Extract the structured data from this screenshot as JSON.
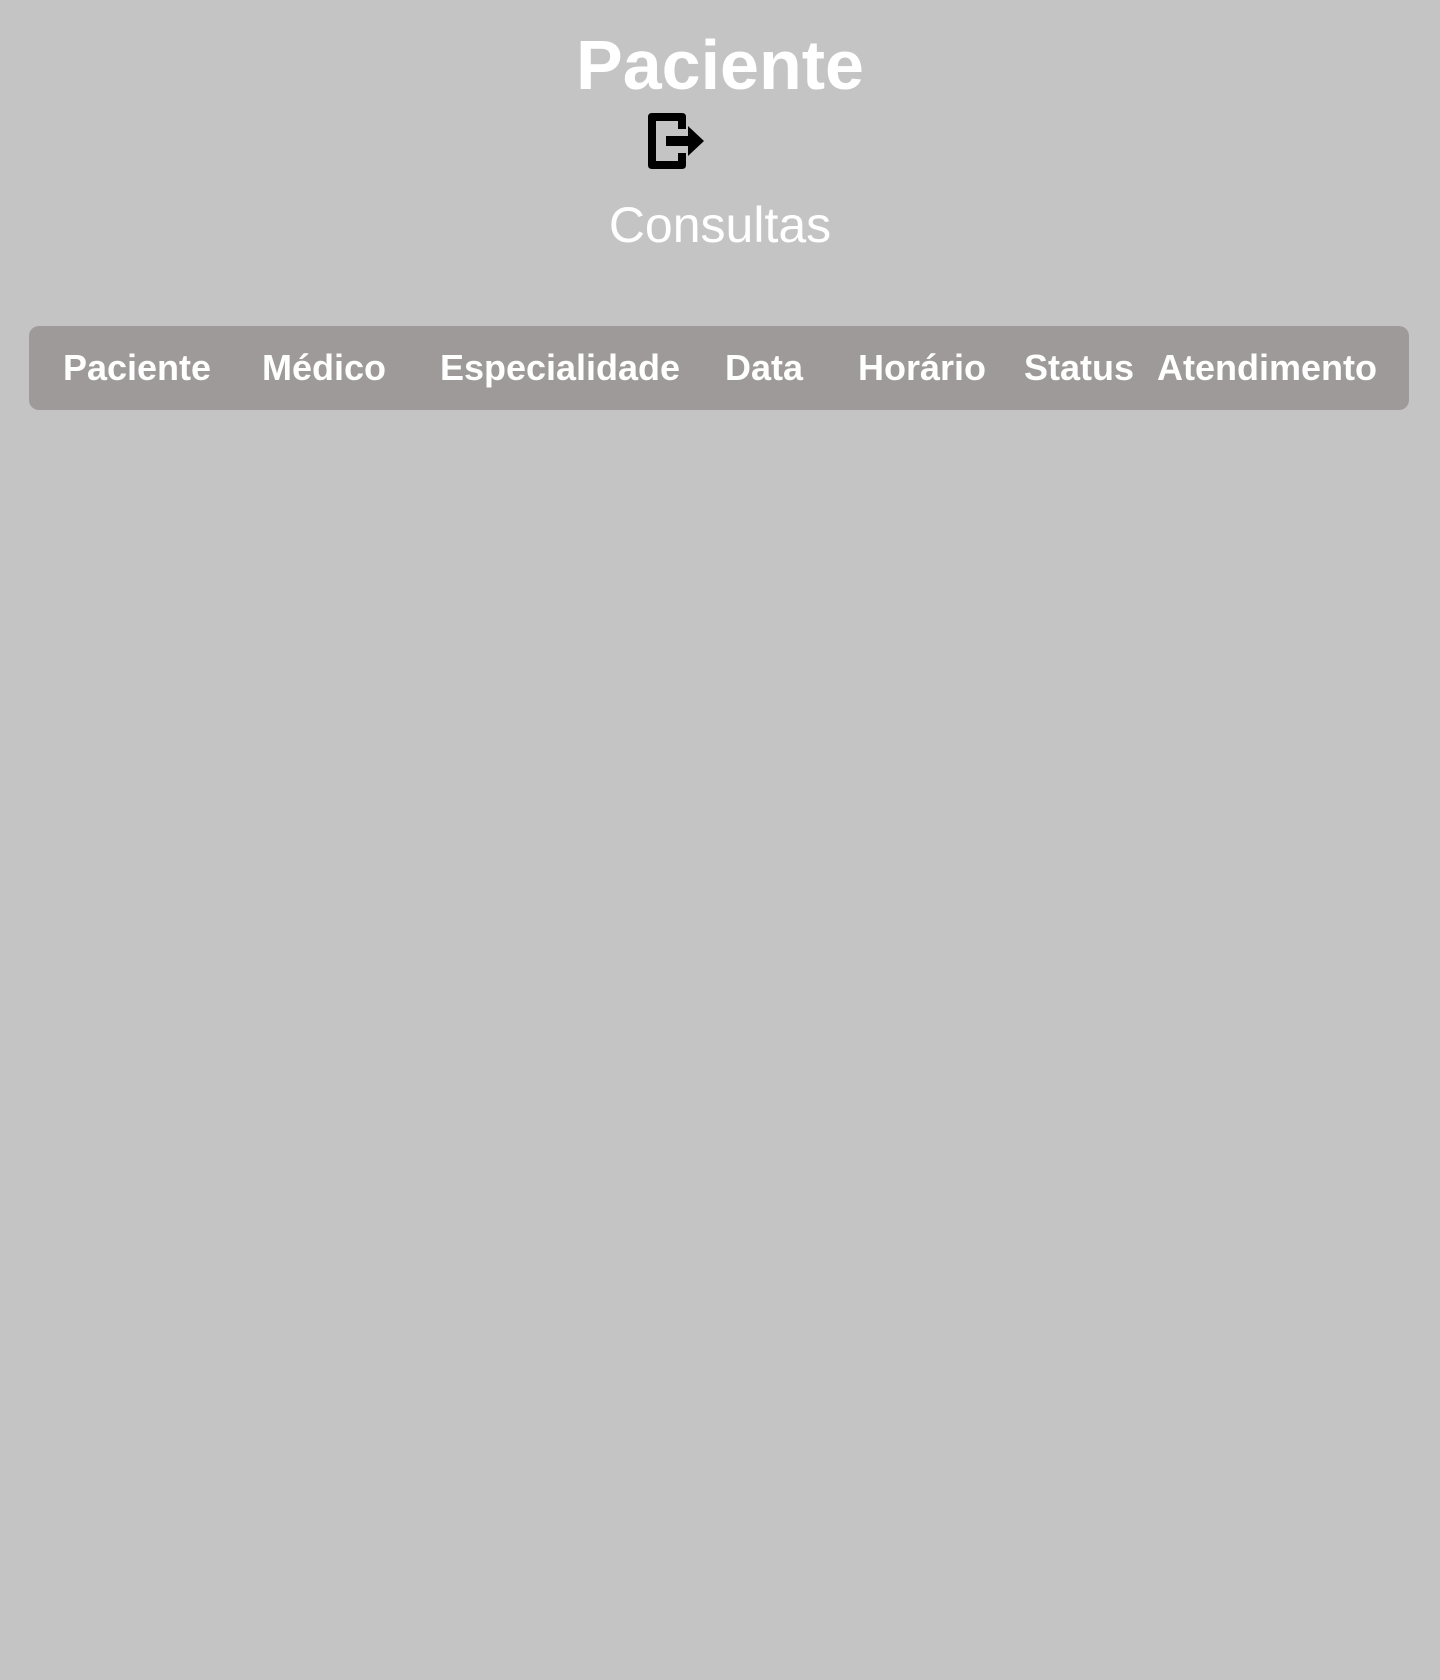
{
  "header": {
    "title": "Paciente",
    "logout_icon": "logout-icon",
    "subtitle": "Consultas"
  },
  "table": {
    "columns": [
      "Paciente",
      "Médico",
      "Especialidade",
      "Data",
      "Horário",
      "Status",
      "Atendimento"
    ],
    "rows": []
  },
  "colors": {
    "background": "#c4c4c4",
    "table_header": "#9e9a99",
    "text": "#ffffff",
    "icon": "#000000"
  }
}
